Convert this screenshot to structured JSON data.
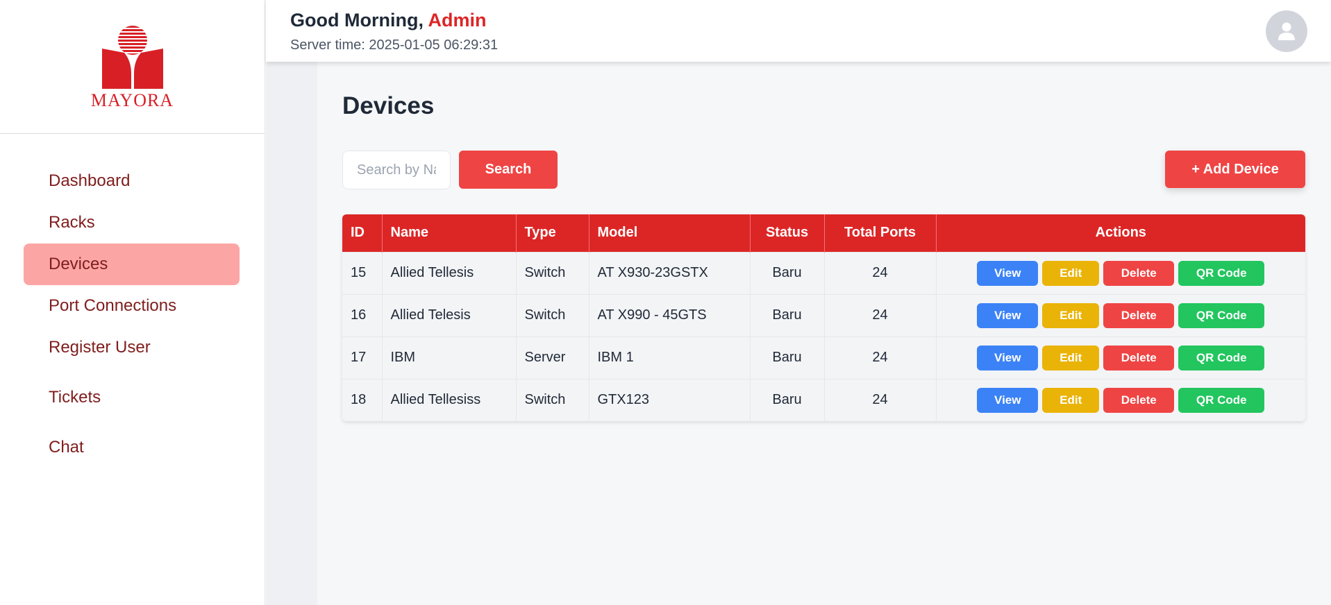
{
  "brand": {
    "name": "MAYORA",
    "color": "#d81f26"
  },
  "sidebar": {
    "items": [
      {
        "label": "Dashboard"
      },
      {
        "label": "Racks"
      },
      {
        "label": "Devices",
        "active": true
      },
      {
        "label": "Port Connections"
      },
      {
        "label": "Register User"
      },
      {
        "label": "Tickets"
      },
      {
        "label": "Chat"
      }
    ]
  },
  "header": {
    "greeting": "Good Morning,",
    "user": "Admin",
    "server_time": "Server time: 2025-01-05 06:29:31",
    "avatar_icon": "user-icon"
  },
  "main": {
    "title": "Devices",
    "search": {
      "placeholder": "Search by Name",
      "value": "",
      "button_label": "Search"
    },
    "add_button_label": "+ Add Device",
    "table": {
      "columns": [
        "ID",
        "Name",
        "Type",
        "Model",
        "Status",
        "Total Ports",
        "Actions"
      ],
      "rows": [
        {
          "id": "15",
          "name": "Allied Tellesis",
          "type": "Switch",
          "model": "AT X930-23GSTX",
          "status": "Baru",
          "total_ports": "24"
        },
        {
          "id": "16",
          "name": "Allied Telesis",
          "type": "Switch",
          "model": "AT X990 - 45GTS",
          "status": "Baru",
          "total_ports": "24"
        },
        {
          "id": "17",
          "name": "IBM",
          "type": "Server",
          "model": "IBM 1",
          "status": "Baru",
          "total_ports": "24"
        },
        {
          "id": "18",
          "name": "Allied Tellesiss",
          "type": "Switch",
          "model": "GTX123",
          "status": "Baru",
          "total_ports": "24"
        }
      ],
      "actions": {
        "view": "View",
        "edit": "Edit",
        "delete": "Delete",
        "qr": "QR Code"
      }
    }
  },
  "colors": {
    "primary": "#dc2626",
    "button_red": "#ef4444",
    "view": "#3b82f6",
    "edit": "#eab308",
    "qr": "#22c55e",
    "active_nav": "#fca5a5"
  }
}
